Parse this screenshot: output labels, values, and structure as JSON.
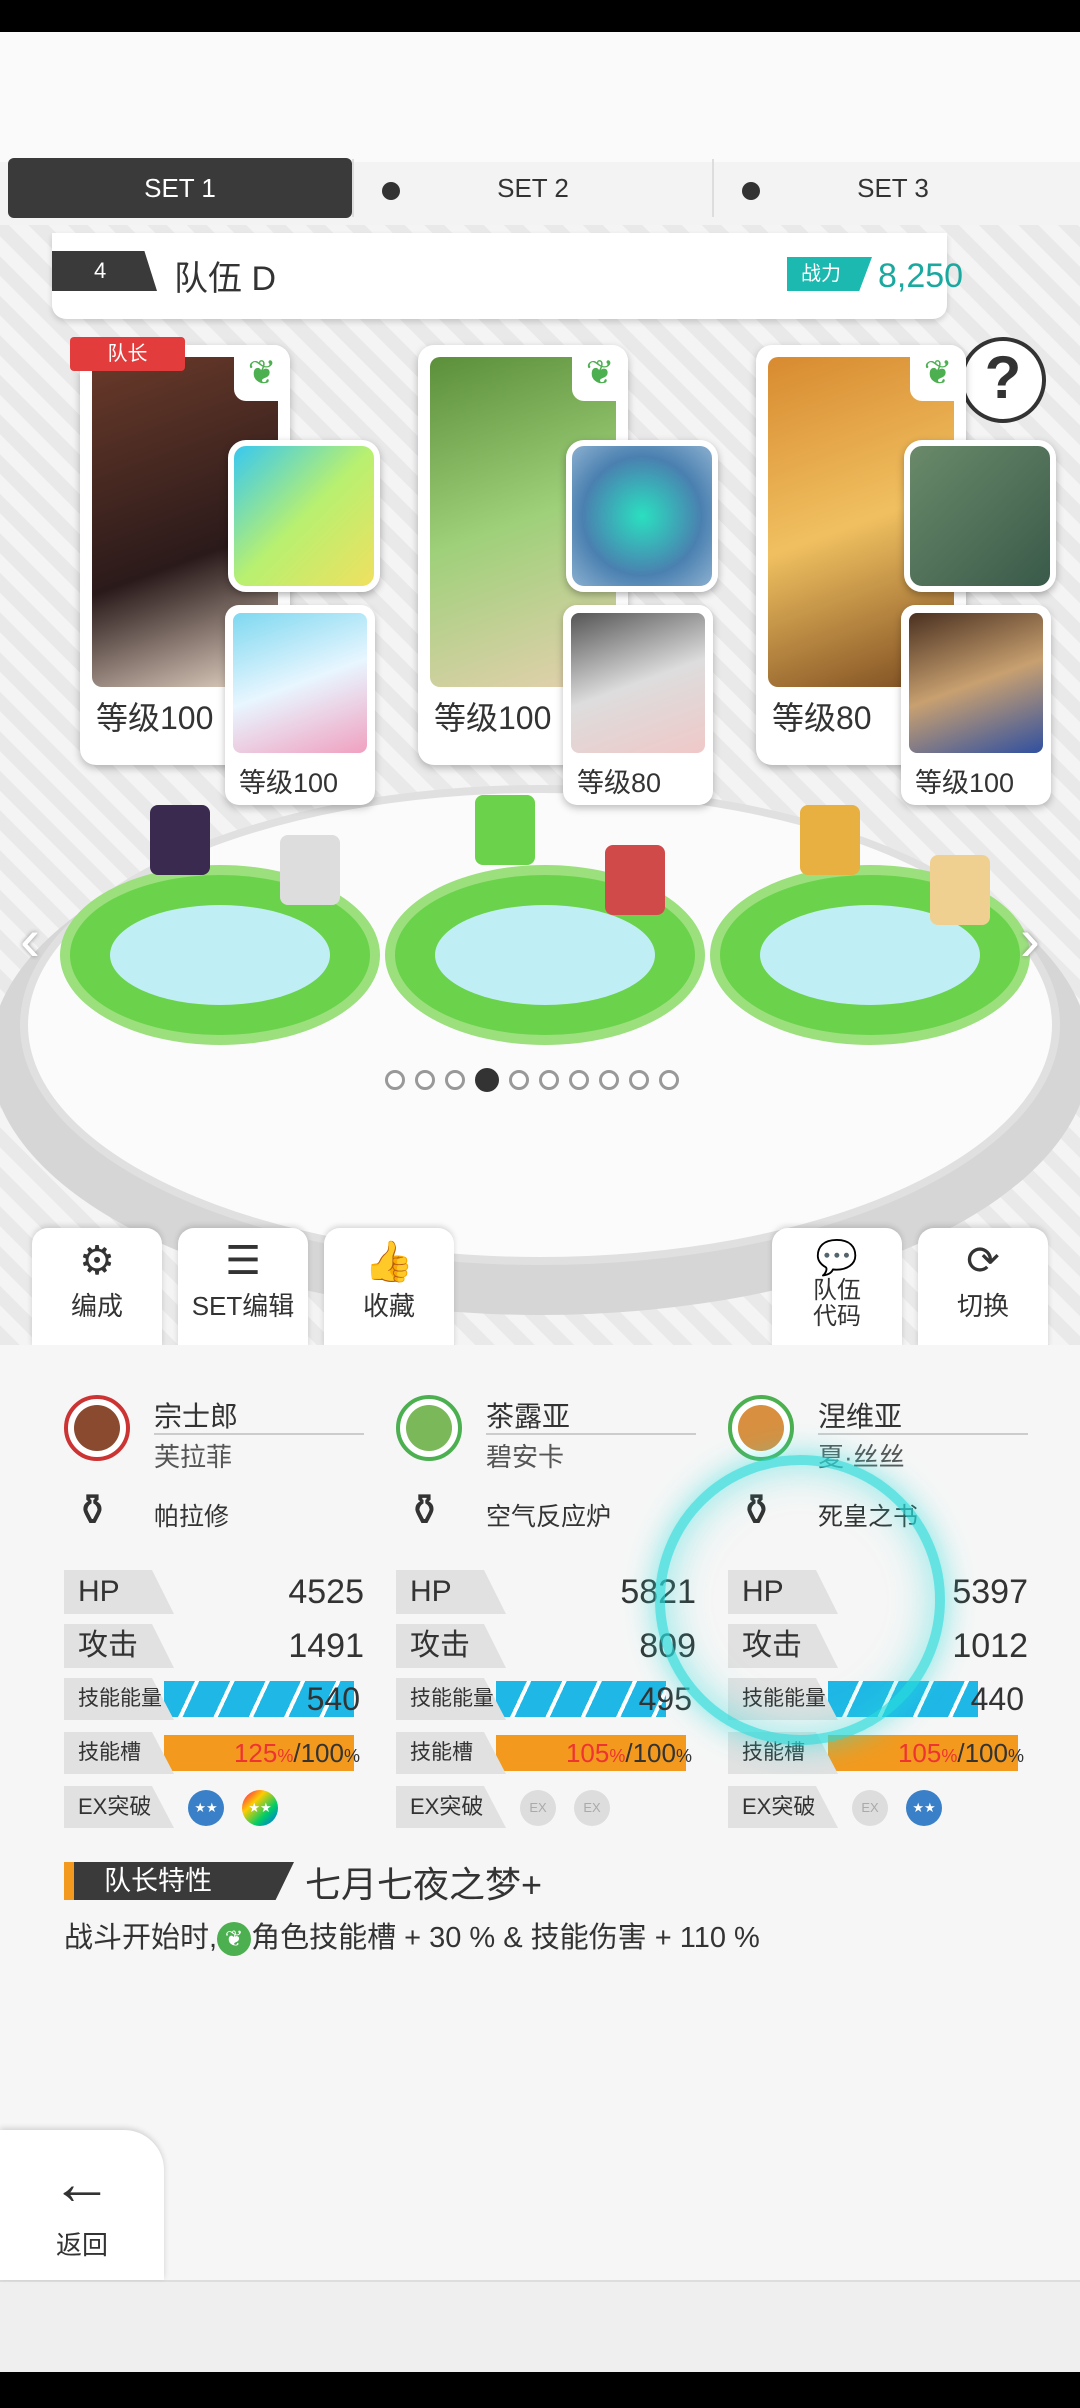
{
  "sets": [
    {
      "label": "SET 1"
    },
    {
      "label": "SET 2"
    },
    {
      "label": "SET 3"
    }
  ],
  "team": {
    "number": "4",
    "name": "队伍 D",
    "power_label": "战力",
    "power_value": "8,250"
  },
  "leader_tag": "队长",
  "help": "?",
  "cards": [
    {
      "main_level": "等级100",
      "sub_level": "等级100"
    },
    {
      "main_level": "等级100",
      "sub_level": "等级80"
    },
    {
      "main_level": "等级80",
      "sub_level": "等级100"
    }
  ],
  "page_dots": {
    "count": 10,
    "active": 3
  },
  "actions": {
    "formation": "编成",
    "set_edit": "SET编辑",
    "favorite": "收藏",
    "team_code_1": "队伍",
    "team_code_2": "代码",
    "switch": "切换"
  },
  "members": [
    {
      "name": "宗士郎",
      "support": "芙拉菲",
      "weapon": "帕拉修",
      "hp_label": "HP",
      "hp": "4525",
      "atk_label": "攻击",
      "atk": "1491",
      "energy_label": "技能能量",
      "energy": "540",
      "gauge_label": "技能槽",
      "gauge_pct": "125",
      "gauge_max": "/100",
      "ex_label": "EX突破"
    },
    {
      "name": "茶露亚",
      "support": "碧安卡",
      "weapon": "空气反应炉",
      "hp_label": "HP",
      "hp": "5821",
      "atk_label": "攻击",
      "atk": "809",
      "energy_label": "技能能量",
      "energy": "495",
      "gauge_label": "技能槽",
      "gauge_pct": "105",
      "gauge_max": "/100",
      "ex_label": "EX突破"
    },
    {
      "name": "涅维亚",
      "support": "夏·丝丝",
      "weapon": "死皇之书",
      "hp_label": "HP",
      "hp": "5397",
      "atk_label": "攻击",
      "atk": "1012",
      "energy_label": "技能能量",
      "energy": "440",
      "gauge_label": "技能槽",
      "gauge_pct": "105",
      "gauge_max": "/100",
      "ex_label": "EX突破"
    }
  ],
  "leader_skill": {
    "label": "队长特性",
    "title": "七月七夜之梦+",
    "desc_before": "战斗开始时,",
    "desc_after": "角色技能槽 + 30 % & 技能伤害 + 110 %"
  },
  "back": {
    "label": "返回"
  },
  "colors": {
    "accent": "#1cb9b0",
    "leader": "#e23c3c",
    "gauge": "#f39a1e",
    "energy": "#1fb7e6",
    "element_leaf": "#4caf50"
  }
}
